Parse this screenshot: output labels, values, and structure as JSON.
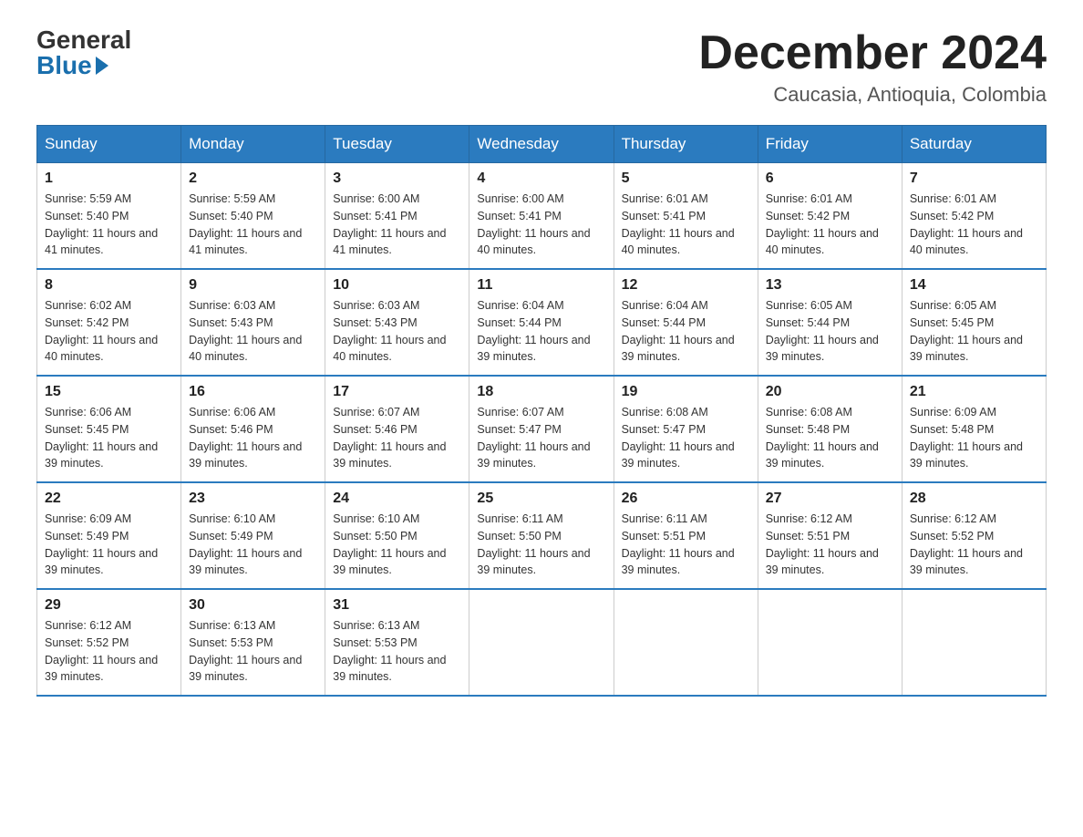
{
  "logo": {
    "general": "General",
    "blue": "Blue"
  },
  "title": {
    "month": "December 2024",
    "location": "Caucasia, Antioquia, Colombia"
  },
  "headers": [
    "Sunday",
    "Monday",
    "Tuesday",
    "Wednesday",
    "Thursday",
    "Friday",
    "Saturday"
  ],
  "weeks": [
    [
      {
        "day": "1",
        "sunrise": "5:59 AM",
        "sunset": "5:40 PM",
        "daylight": "11 hours and 41 minutes."
      },
      {
        "day": "2",
        "sunrise": "5:59 AM",
        "sunset": "5:40 PM",
        "daylight": "11 hours and 41 minutes."
      },
      {
        "day": "3",
        "sunrise": "6:00 AM",
        "sunset": "5:41 PM",
        "daylight": "11 hours and 41 minutes."
      },
      {
        "day": "4",
        "sunrise": "6:00 AM",
        "sunset": "5:41 PM",
        "daylight": "11 hours and 40 minutes."
      },
      {
        "day": "5",
        "sunrise": "6:01 AM",
        "sunset": "5:41 PM",
        "daylight": "11 hours and 40 minutes."
      },
      {
        "day": "6",
        "sunrise": "6:01 AM",
        "sunset": "5:42 PM",
        "daylight": "11 hours and 40 minutes."
      },
      {
        "day": "7",
        "sunrise": "6:01 AM",
        "sunset": "5:42 PM",
        "daylight": "11 hours and 40 minutes."
      }
    ],
    [
      {
        "day": "8",
        "sunrise": "6:02 AM",
        "sunset": "5:42 PM",
        "daylight": "11 hours and 40 minutes."
      },
      {
        "day": "9",
        "sunrise": "6:03 AM",
        "sunset": "5:43 PM",
        "daylight": "11 hours and 40 minutes."
      },
      {
        "day": "10",
        "sunrise": "6:03 AM",
        "sunset": "5:43 PM",
        "daylight": "11 hours and 40 minutes."
      },
      {
        "day": "11",
        "sunrise": "6:04 AM",
        "sunset": "5:44 PM",
        "daylight": "11 hours and 39 minutes."
      },
      {
        "day": "12",
        "sunrise": "6:04 AM",
        "sunset": "5:44 PM",
        "daylight": "11 hours and 39 minutes."
      },
      {
        "day": "13",
        "sunrise": "6:05 AM",
        "sunset": "5:44 PM",
        "daylight": "11 hours and 39 minutes."
      },
      {
        "day": "14",
        "sunrise": "6:05 AM",
        "sunset": "5:45 PM",
        "daylight": "11 hours and 39 minutes."
      }
    ],
    [
      {
        "day": "15",
        "sunrise": "6:06 AM",
        "sunset": "5:45 PM",
        "daylight": "11 hours and 39 minutes."
      },
      {
        "day": "16",
        "sunrise": "6:06 AM",
        "sunset": "5:46 PM",
        "daylight": "11 hours and 39 minutes."
      },
      {
        "day": "17",
        "sunrise": "6:07 AM",
        "sunset": "5:46 PM",
        "daylight": "11 hours and 39 minutes."
      },
      {
        "day": "18",
        "sunrise": "6:07 AM",
        "sunset": "5:47 PM",
        "daylight": "11 hours and 39 minutes."
      },
      {
        "day": "19",
        "sunrise": "6:08 AM",
        "sunset": "5:47 PM",
        "daylight": "11 hours and 39 minutes."
      },
      {
        "day": "20",
        "sunrise": "6:08 AM",
        "sunset": "5:48 PM",
        "daylight": "11 hours and 39 minutes."
      },
      {
        "day": "21",
        "sunrise": "6:09 AM",
        "sunset": "5:48 PM",
        "daylight": "11 hours and 39 minutes."
      }
    ],
    [
      {
        "day": "22",
        "sunrise": "6:09 AM",
        "sunset": "5:49 PM",
        "daylight": "11 hours and 39 minutes."
      },
      {
        "day": "23",
        "sunrise": "6:10 AM",
        "sunset": "5:49 PM",
        "daylight": "11 hours and 39 minutes."
      },
      {
        "day": "24",
        "sunrise": "6:10 AM",
        "sunset": "5:50 PM",
        "daylight": "11 hours and 39 minutes."
      },
      {
        "day": "25",
        "sunrise": "6:11 AM",
        "sunset": "5:50 PM",
        "daylight": "11 hours and 39 minutes."
      },
      {
        "day": "26",
        "sunrise": "6:11 AM",
        "sunset": "5:51 PM",
        "daylight": "11 hours and 39 minutes."
      },
      {
        "day": "27",
        "sunrise": "6:12 AM",
        "sunset": "5:51 PM",
        "daylight": "11 hours and 39 minutes."
      },
      {
        "day": "28",
        "sunrise": "6:12 AM",
        "sunset": "5:52 PM",
        "daylight": "11 hours and 39 minutes."
      }
    ],
    [
      {
        "day": "29",
        "sunrise": "6:12 AM",
        "sunset": "5:52 PM",
        "daylight": "11 hours and 39 minutes."
      },
      {
        "day": "30",
        "sunrise": "6:13 AM",
        "sunset": "5:53 PM",
        "daylight": "11 hours and 39 minutes."
      },
      {
        "day": "31",
        "sunrise": "6:13 AM",
        "sunset": "5:53 PM",
        "daylight": "11 hours and 39 minutes."
      },
      null,
      null,
      null,
      null
    ]
  ],
  "labels": {
    "sunrise": "Sunrise:",
    "sunset": "Sunset:",
    "daylight": "Daylight:"
  }
}
